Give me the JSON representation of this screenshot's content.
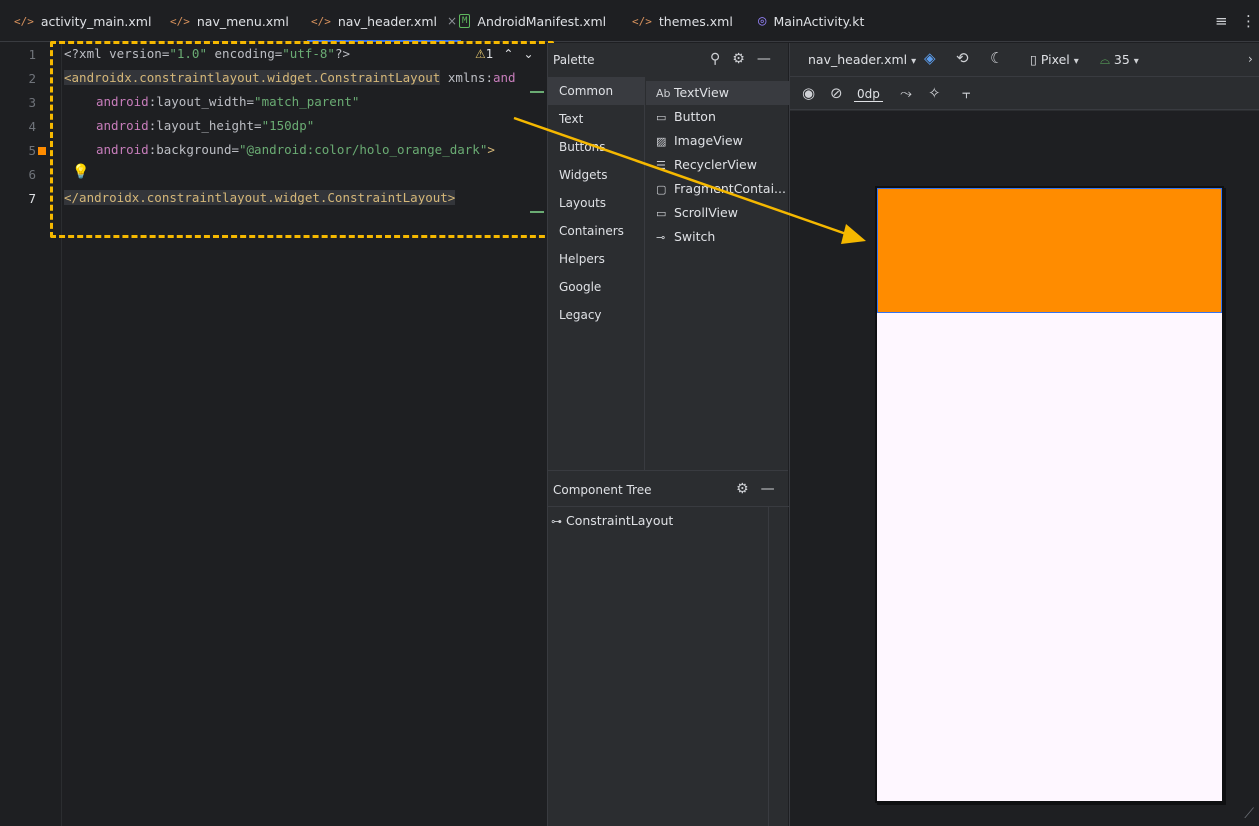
{
  "tabs": [
    {
      "label": "activity_main.xml",
      "icon": "xml-code-icon",
      "active": false
    },
    {
      "label": "nav_menu.xml",
      "icon": "xml-code-icon",
      "active": false
    },
    {
      "label": "nav_header.xml",
      "icon": "xml-code-icon",
      "active": true
    },
    {
      "label": "AndroidManifest.xml",
      "icon": "manifest-icon",
      "active": false
    },
    {
      "label": "themes.xml",
      "icon": "xml-code-icon",
      "active": false
    },
    {
      "label": "MainActivity.kt",
      "icon": "kotlin-icon",
      "active": false
    }
  ],
  "tab_close": "×",
  "tab_menu_icon": "≡",
  "tab_overflow_icon": "⋮",
  "editor": {
    "line_numbers": [
      "1",
      "2",
      "3",
      "4",
      "5",
      "6",
      "7"
    ],
    "current_line": "7",
    "warning_count": "1",
    "lines": {
      "l1": {
        "a": "<?xml version=",
        "b": "\"1.0\"",
        "c": " encoding=",
        "d": "\"utf-8\"",
        "e": "?>"
      },
      "l2": {
        "a": "<androidx.constraintlayout.widget.ConstraintLayout",
        "b": " xmlns:",
        "c": "and"
      },
      "l3": {
        "a": "android",
        "b": ":layout_width=",
        "c": "\"match_parent\""
      },
      "l4": {
        "a": "android",
        "b": ":layout_height=",
        "c": "\"150dp\""
      },
      "l5": {
        "a": "android",
        "b": ":background=",
        "c": "\"@android:color/holo_orange_dark\"",
        "d": ">"
      },
      "l7": {
        "a": "</androidx.constraintlayout.widget.ConstraintLayout>"
      }
    }
  },
  "palette": {
    "title": "Palette",
    "categories": [
      "Common",
      "Text",
      "Buttons",
      "Widgets",
      "Layouts",
      "Containers",
      "Helpers",
      "Google",
      "Legacy"
    ],
    "selected_category": "Common",
    "items": [
      {
        "label": "TextView",
        "icon": "Ab"
      },
      {
        "label": "Button",
        "icon": "▭"
      },
      {
        "label": "ImageView",
        "icon": "▨"
      },
      {
        "label": "RecyclerView",
        "icon": "☰"
      },
      {
        "label": "FragmentContai...",
        "icon": "▢"
      },
      {
        "label": "ScrollView",
        "icon": "▭"
      },
      {
        "label": "Switch",
        "icon": "⊸"
      }
    ]
  },
  "component_tree": {
    "title": "Component Tree",
    "root": "ConstraintLayout"
  },
  "design": {
    "file_selector": "nav_header.xml",
    "device": "Pixel",
    "api_level": "35",
    "margin_value": "0dp"
  },
  "preview": {
    "header_color": "#ff8c00",
    "background_color": "#fef7ff"
  },
  "annotation_color": "#f5b800"
}
